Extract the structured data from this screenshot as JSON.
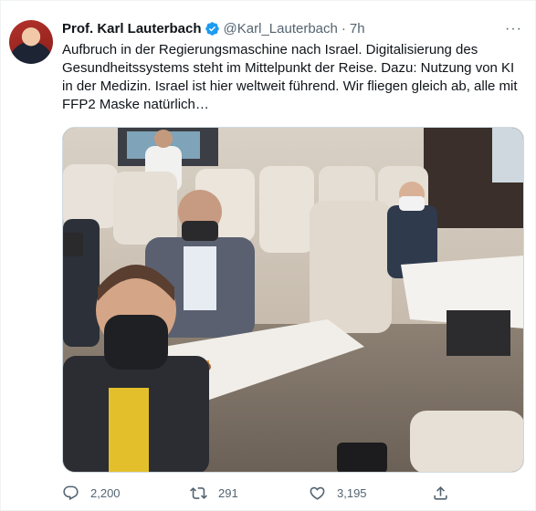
{
  "tweet": {
    "author_name": "Prof. Karl Lauterbach",
    "handle": "@Karl_Lauterbach",
    "separator": "·",
    "time": "7h",
    "more": "···",
    "text": "Aufbruch in der Regierungsmaschine nach Israel. Digitalisierung des Gesundheitssystems steht im Mittelpunkt der Reise. Dazu: Nutzung von KI in der Medizin. Israel ist hier weltweit führend. Wir fliegen gleich ab, alle mit FFP2 Maske natürlich…"
  },
  "actions": {
    "replies": "2,200",
    "retweets": "291",
    "likes": "3,195"
  },
  "colors": {
    "verified": "#1d9bf0",
    "muted": "#536471"
  }
}
